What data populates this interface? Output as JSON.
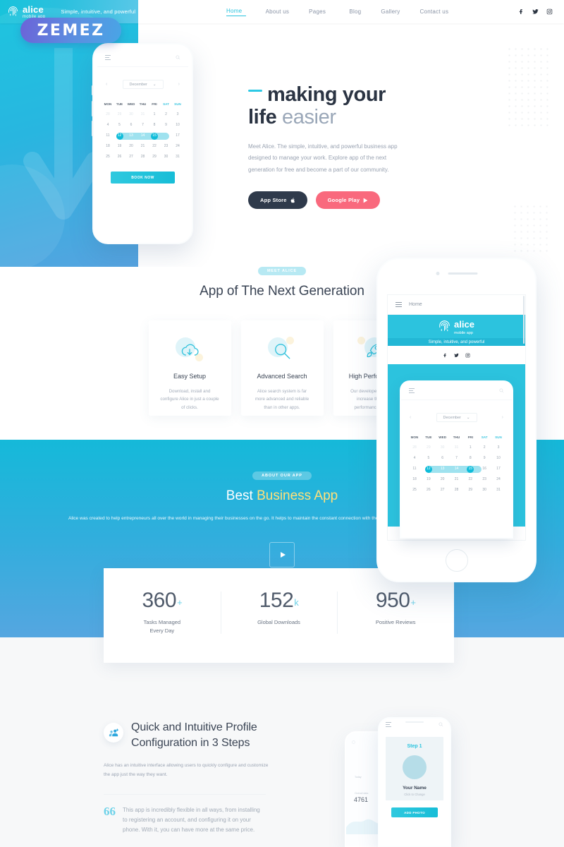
{
  "header": {
    "logo": {
      "name": "alice",
      "sub": "mobile app",
      "icon": "fingerprint-icon"
    },
    "tagline": "Simple, intuitive, and powerful",
    "nav": [
      {
        "label": "Home",
        "active": true,
        "caret": "ˇ"
      },
      {
        "label": "About us",
        "active": false
      },
      {
        "label": "Pages",
        "active": false,
        "caret": "ˇ"
      },
      {
        "label": "Blog",
        "active": false
      },
      {
        "label": "Gallery",
        "active": false
      },
      {
        "label": "Contact us",
        "active": false
      }
    ],
    "social": [
      "facebook-icon",
      "twitter-icon",
      "instagram-icon"
    ]
  },
  "zemez_badge": {
    "label": "ZEMEZ"
  },
  "hero": {
    "title_line1_bold": "making your",
    "title_line2_bold": "life",
    "title_line2_light": "easier",
    "subtitle": "Meet Alice. The simple, intuitive, and powerful business app designed to manage your work. Explore app of the next generation for free and become a part of our community.",
    "buttons": [
      {
        "label": "App Store",
        "icon": "apple-icon",
        "color": "#2F3A4B"
      },
      {
        "label": "Google Play",
        "icon": "play-triangle-icon",
        "color": "#F9697D"
      }
    ]
  },
  "calendar": {
    "month": "December",
    "prev": "‹",
    "next": "›",
    "dow": [
      "MON",
      "TUE",
      "WED",
      "THU",
      "FRI",
      "SAT",
      "SUN"
    ],
    "weeks": [
      [
        "28",
        "29",
        "30",
        "31",
        "1",
        "2",
        "3"
      ],
      [
        "4",
        "5",
        "6",
        "7",
        "8",
        "9",
        "10"
      ],
      [
        "11",
        "12",
        "13",
        "14",
        "15",
        "16",
        "17"
      ],
      [
        "18",
        "19",
        "20",
        "21",
        "22",
        "23",
        "24"
      ],
      [
        "25",
        "26",
        "27",
        "28",
        "29",
        "30",
        "31"
      ]
    ],
    "selected_range": [
      "12",
      "13",
      "14",
      "15"
    ],
    "book_label": "BOOK NOW"
  },
  "features": {
    "badge": "MEET ALICE",
    "title": "App of The Next Generation",
    "cards": [
      {
        "icon": "cloud-download-icon",
        "title": "Easy Setup",
        "text": "Download, install and configure Alice in just a couple of clicks."
      },
      {
        "icon": "search-icon",
        "title": "Advanced Search",
        "text": "Alice search system is far more advanced and reliable than in other apps."
      },
      {
        "icon": "rocket-icon",
        "title": "High Performance",
        "text": "Our developers regularly increase the app's performance for you."
      }
    ]
  },
  "about": {
    "badge": "ABOUT OUR APP",
    "title_white": "Best ",
    "title_yellow": "Business App",
    "text": "Alice was created to help entrepreneurs all over the world in managing their businesses on the go. It helps to maintain the constant connection with their employees while also offering dozens of great features.",
    "play_icon": "play-button-icon"
  },
  "stats": [
    {
      "number": "360",
      "suffix": "+",
      "label": "Tasks Managed\nEvery Day"
    },
    {
      "number": "152",
      "suffix": "k",
      "label": "Global Downloads"
    },
    {
      "number": "950",
      "suffix": "+",
      "label": "Positive Reviews"
    }
  ],
  "profile": {
    "icon": "add-user-icon",
    "title": "Quick and Intuitive Profile Configuration in 3 Steps",
    "text": "Alice has an intuitive interface allowing users to quickly configure and customize the app just the way they want.",
    "quote_mark": "66",
    "quote": "This app is incredibly flexible in all ways, from installing to registering an account, and configuring it on your phone. With it, you can have more at the same price."
  },
  "big_phone": {
    "home_label": "Home",
    "logo_name": "alice",
    "logo_sub": "mobile app",
    "tagline": "Simple, intuitive, and powerful",
    "social": [
      "facebook-icon",
      "twitter-icon",
      "instagram-icon"
    ]
  },
  "step_phone": {
    "step": "Step 1",
    "name": "Your Name",
    "hint": "Click to Change",
    "button": "ADD PHOTO"
  },
  "back_phone": {
    "number": "4761"
  },
  "colors": {
    "cyan": "#2CC3DE",
    "blue": "#55A6E0",
    "coral": "#F9697D",
    "dark": "#2F3A4B",
    "yellow": "#FFE07A",
    "text": "#3A4454"
  }
}
